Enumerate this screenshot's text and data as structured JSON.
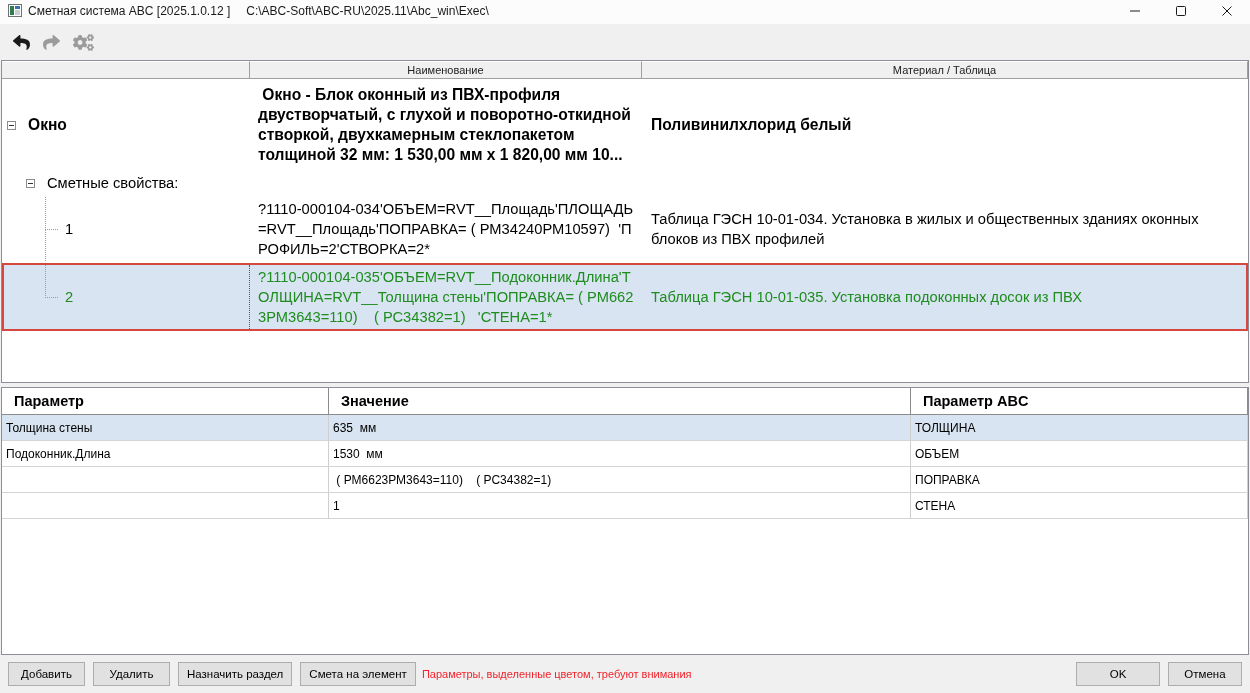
{
  "window": {
    "title": "Сметная система ABC [2025.1.0.12 ]",
    "path": "C:\\ABC-Soft\\ABC-RU\\2025.11\\Abc_win\\Exec\\"
  },
  "toolbar": [
    {
      "kind": "undo",
      "disabled": false
    },
    {
      "kind": "redo",
      "disabled": true
    },
    {
      "kind": "settings",
      "disabled": true
    }
  ],
  "tree": {
    "columns": [
      "Наименование",
      "Материал / Таблица"
    ],
    "items": [
      {
        "label": "Окно",
        "name": " Окно - Блок оконный из ПВХ-профиля двустворчатый, с глухой и поворотно-откидной створкой, двухкамерным стеклопакетом толщиной 32 мм: 1 530,00 мм х 1 820,00 мм 10...",
        "material": "Поливинилхлорид белый",
        "selected": false,
        "expanded": true,
        "children": [
          {
            "label": "Сметные свойства:",
            "selected": false,
            "expanded": true,
            "children": [
              {
                "label": "1",
                "name": "?1110-000104-034'ОБЪЕМ=RVT__Площадь'ПЛОЩАДЬ=RVT__Площадь'ПОПРАВКА= ( РМ34240РМ10597)  'ПРОФИЛЬ=2'СТВОРКА=2*",
                "material": "Таблица ГЭСН 10-01-034. Установка в жилых и общественных зданиях оконных блоков из ПВХ профилей",
                "selected": false,
                "highlighted": false
              },
              {
                "label": "2",
                "name": "?1110-000104-035'ОБЪЕМ=RVT__Подоконник.Длина'ТОЛЩИНА=RVT__Толщина стены'ПОПРАВКА= ( РМ6623РМ3643=110)    ( РС34382=1)   'СТЕНА=1*",
                "material": "Таблица ГЭСН 10-01-035. Установка подоконных досок из ПВХ",
                "selected": true,
                "highlighted": true
              }
            ]
          }
        ]
      }
    ]
  },
  "parameters": {
    "columns": [
      "Параметр",
      "Значение",
      "Параметр ABC"
    ],
    "rows": [
      {
        "parameter": "Толщина стены",
        "value": "635  мм",
        "abc_parameter": "ТОЛЩИНА",
        "selected": true
      },
      {
        "parameter": "Подоконник.Длина",
        "value": "1530  мм",
        "abc_parameter": "ОБЪЕМ",
        "selected": false
      },
      {
        "value": " ( РМ6623РМ3643=110)    ( РС34382=1)",
        "abc_parameter": "ПОПРАВКА",
        "selected": false
      },
      {
        "value": "1",
        "abc_parameter": "СТЕНА",
        "selected": false
      }
    ]
  },
  "footer": {
    "buttons": [
      "Добавить",
      "Удалить",
      "Назначить раздел",
      "Смета на элемент"
    ],
    "message": "Параметры, выделенные цветом, требуют внимания",
    "dialog_buttons": [
      "OK",
      "Отмена"
    ]
  }
}
